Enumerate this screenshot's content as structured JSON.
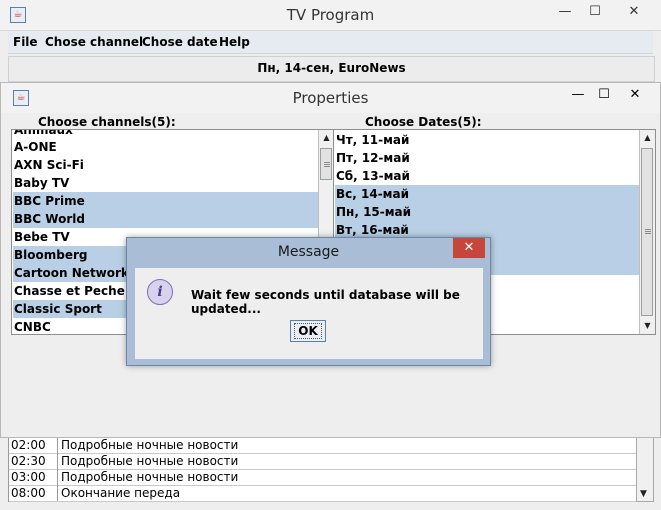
{
  "main_window": {
    "title": "TV Program",
    "controls": {
      "minimize": "—",
      "maximize": "☐",
      "close": "✕"
    },
    "menu": [
      "File",
      "Chose channel",
      "Chose date",
      "Help"
    ],
    "status": "Пн, 14-сен, EuroNews",
    "schedule": [
      {
        "time": "02:00",
        "title": "Подробные ночные новости"
      },
      {
        "time": "02:30",
        "title": "Подробные ночные новости"
      },
      {
        "time": "03:00",
        "title": "Подробные ночные новости"
      },
      {
        "time": "08:00",
        "title": "Окончание переда"
      }
    ]
  },
  "properties_dialog": {
    "title": "Properties",
    "controls": {
      "minimize": "—",
      "maximize": "☐",
      "close": "✕"
    },
    "channels_label": "Choose channels(5):",
    "dates_label": "Choose Dates(5):",
    "channels": [
      {
        "name": "Animaux",
        "selected": false
      },
      {
        "name": "A-ONE",
        "selected": false
      },
      {
        "name": "AXN Sci-Fi",
        "selected": false
      },
      {
        "name": "Baby TV",
        "selected": false
      },
      {
        "name": "BBC Prime",
        "selected": true
      },
      {
        "name": "BBC World",
        "selected": true
      },
      {
        "name": "Bebe TV",
        "selected": false
      },
      {
        "name": "Bloomberg",
        "selected": true
      },
      {
        "name": "Cartoon Network",
        "selected": true
      },
      {
        "name": "Chasse et Peche",
        "selected": false
      },
      {
        "name": "Classic Sport",
        "selected": true
      },
      {
        "name": "CNBC",
        "selected": false
      }
    ],
    "dates": [
      {
        "label": "Чт, 11-май",
        "selected": false
      },
      {
        "label": "Пт, 12-май",
        "selected": false
      },
      {
        "label": "Сб, 13-май",
        "selected": false
      },
      {
        "label": "Вс, 14-май",
        "selected": true
      },
      {
        "label": "Пн, 15-май",
        "selected": true
      },
      {
        "label": "Вт, 16-май",
        "selected": true
      },
      {
        "label": "",
        "selected": true
      },
      {
        "label": "",
        "selected": true
      }
    ]
  },
  "message_dialog": {
    "title": "Message",
    "close": "✕",
    "icon": "info-icon",
    "icon_glyph": "i",
    "text": "Wait few seconds until database will be updated...",
    "ok_label": "OK"
  },
  "colors": {
    "selection": "#b8cfe5",
    "dialog_frame": "#a9bed6",
    "close_button": "#c7463c"
  }
}
